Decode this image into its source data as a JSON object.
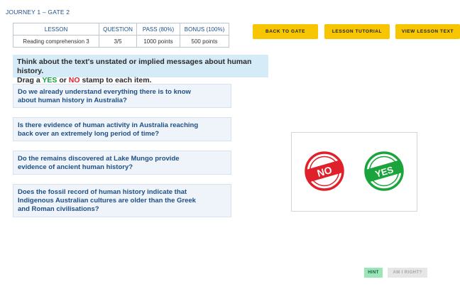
{
  "breadcrumb": "JOURNEY 1 – GATE 2",
  "lesson_table": {
    "headers": [
      "LESSON",
      "QUESTION",
      "PASS (80%)",
      "BONUS (100%)"
    ],
    "row": [
      "Reading comprehension 3",
      "3/5",
      "1000 points",
      "500 points"
    ]
  },
  "top_buttons": {
    "back_to_gate": "BACK TO GATE",
    "lesson_tutorial": "LESSON TUTORIAL",
    "view_lesson_text": "VIEW LESSON TEXT"
  },
  "instructions": {
    "line1": "Think about the text's unstated or implied messages about human history.",
    "drag_a": "Drag a ",
    "yes": "YES",
    "or": " or ",
    "no": "NO",
    "stamp_to_each": " stamp to each item."
  },
  "questions": [
    "Do we already understand everything there is to know about human history in Australia?",
    "Is there evidence of human activity in Australia reaching back over an extremely long period of time?",
    "Do the remains discovered at Lake Mungo provide evidence of ancient human history?",
    "Does the fossil record of human history indicate that Indigenous Australian cultures are older than the Greek and Roman civilisations?"
  ],
  "stamps": {
    "no_label": "NO",
    "yes_label": "YES"
  },
  "bottom_buttons": {
    "hint": "HINT",
    "am_i_right": "AM I RIGHT?"
  },
  "colors": {
    "yellow_button": "#f7c600",
    "instruction_bg": "#d6ebf8",
    "question_bg": "#eef4f9",
    "question_text": "#1f4f85",
    "yes_green": "#1aa43b",
    "no_red": "#e0202a",
    "hint_green": "#9be6b9"
  }
}
